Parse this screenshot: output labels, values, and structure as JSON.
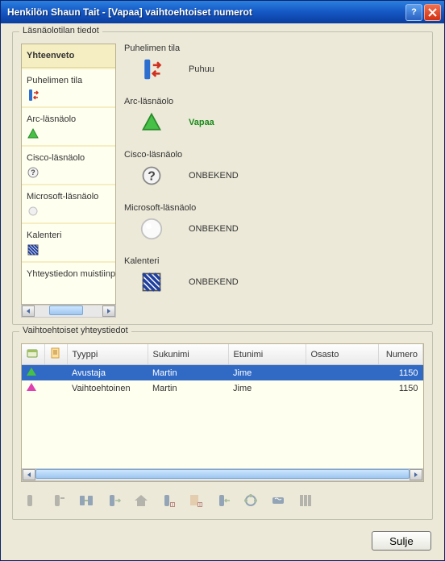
{
  "title": "Henkilön Shaun Tait - [Vapaa] vaihtoehtoiset numerot",
  "group1": {
    "legend": "Läsnäolotilan tiedot",
    "summary": "Yhteenveto",
    "sections": {
      "phone": "Puhelimen tila",
      "arc": "Arc-läsnäolo",
      "cisco": "Cisco-läsnäolo",
      "ms": "Microsoft-läsnäolo",
      "cal": "Kalenteri",
      "note": "Yhteystiedon muistiinpa"
    },
    "values": {
      "phone": "Puhuu",
      "arc": "Vapaa",
      "cisco": "ONBEKEND",
      "ms": "ONBEKEND",
      "cal": "ONBEKEND"
    }
  },
  "group2": {
    "legend": "Vaihtoehtoiset yhteystiedot",
    "headers": {
      "type": "Tyyppi",
      "last": "Sukunimi",
      "first": "Etunimi",
      "dept": "Osasto",
      "num": "Numero"
    },
    "rows": [
      {
        "tri": "g",
        "type": "Avustaja",
        "last": "Martin",
        "first": "Jime",
        "dept": "",
        "num": "1150",
        "selected": true
      },
      {
        "tri": "p",
        "type": "Vaihtoehtoinen",
        "last": "Martin",
        "first": "Jime",
        "dept": "",
        "num": "1150",
        "selected": false
      }
    ]
  },
  "buttons": {
    "close": "Sulje"
  },
  "colors": {
    "accentGreen": "#1a8a1a",
    "selection": "#316ac5"
  }
}
